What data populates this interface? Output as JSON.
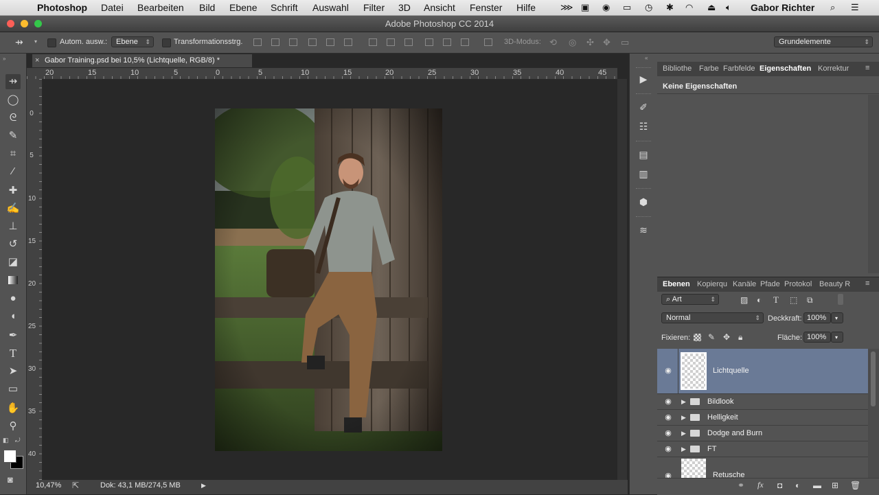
{
  "menubar": {
    "app": "Photoshop",
    "items": [
      "Datei",
      "Bearbeiten",
      "Bild",
      "Ebene",
      "Schrift",
      "Auswahl",
      "Filter",
      "3D",
      "Ansicht",
      "Fenster",
      "Hilfe"
    ],
    "user": "Gabor Richter"
  },
  "window": {
    "title": "Adobe Photoshop CC 2014"
  },
  "options": {
    "auto_select_label": "Autom. ausw.:",
    "auto_select_value": "Ebene",
    "transform_label": "Transformationsstrg.",
    "mode3d_label": "3D-Modus:",
    "workspace": "Grundelemente"
  },
  "document": {
    "tab_title": "Gabor Training.psd bei 10,5% (Lichtquelle, RGB/8) *",
    "ruler_top": [
      "20",
      "15",
      "10",
      "5",
      "0",
      "5",
      "10",
      "15",
      "20",
      "25",
      "30",
      "35",
      "40",
      "45"
    ],
    "ruler_left": [
      "0",
      "5",
      "10",
      "15",
      "20",
      "25",
      "30",
      "35",
      "40"
    ]
  },
  "status": {
    "zoom": "10,47%",
    "doc_info": "Dok: 43,1 MB/274,5 MB"
  },
  "properties_panel": {
    "tabs": [
      "Bibliothe",
      "Farbe",
      "Farbfelde",
      "Eigenschaften",
      "Korrektur"
    ],
    "active_tab": 3,
    "message": "Keine Eigenschaften"
  },
  "layers_panel": {
    "tabs": [
      "Ebenen",
      "Kopierqu",
      "Kanäle",
      "Pfade",
      "Protokol",
      "Beauty R"
    ],
    "active_tab": 0,
    "filter": "Art",
    "blend_mode": "Normal",
    "opacity_label": "Deckkraft:",
    "opacity": "100%",
    "lock_label": "Fixieren:",
    "fill_label": "Fläche:",
    "fill": "100%",
    "layers": [
      {
        "name": "Lichtquelle",
        "type": "layer",
        "selected": true
      },
      {
        "name": "Bildlook",
        "type": "group"
      },
      {
        "name": "Helligkeit",
        "type": "group"
      },
      {
        "name": "Dodge and Burn",
        "type": "group"
      },
      {
        "name": "FT",
        "type": "group"
      },
      {
        "name": "Retusche",
        "type": "layer"
      }
    ]
  },
  "colors": {
    "selected_layer": "#6a7a96",
    "panel": "#535353",
    "canvas": "#282828"
  }
}
